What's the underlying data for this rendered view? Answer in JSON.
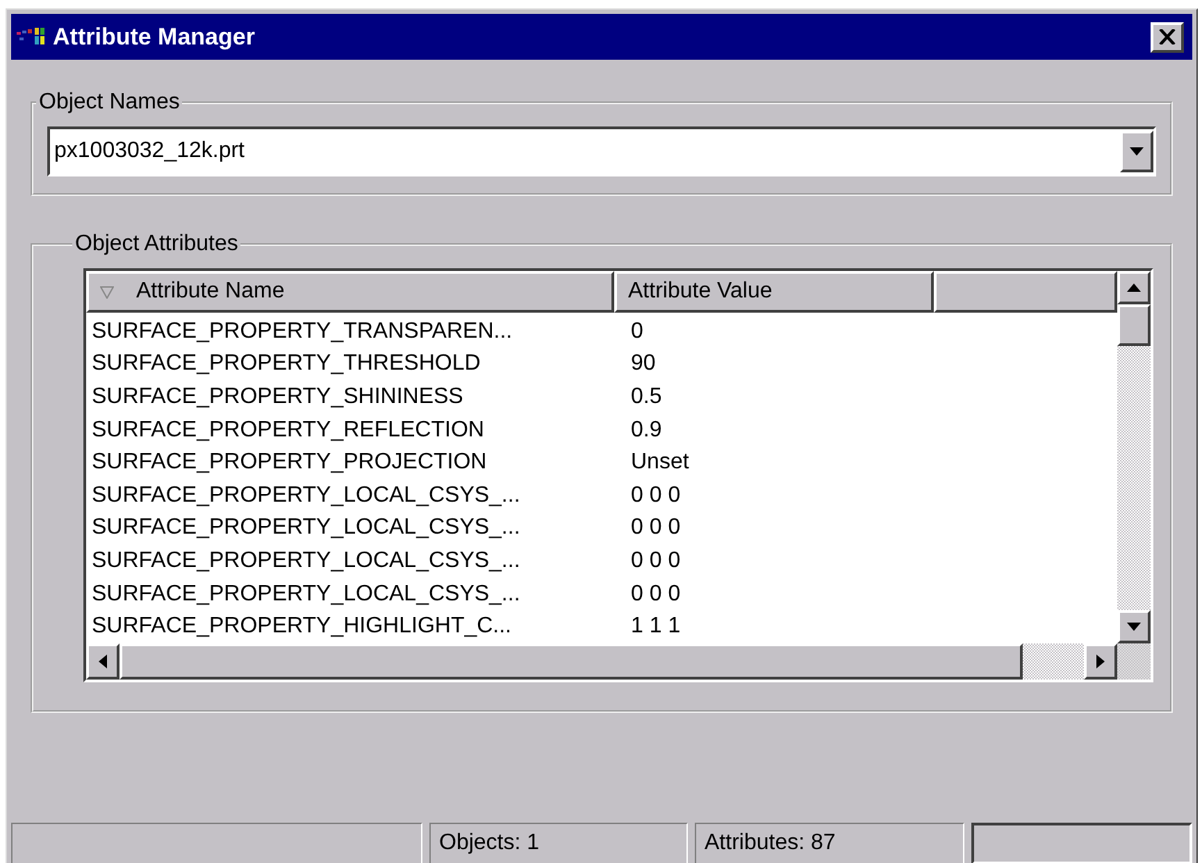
{
  "window": {
    "title": "Attribute Manager"
  },
  "object_names": {
    "label": "Object Names",
    "value": "px1003032_12k.prt"
  },
  "object_attributes": {
    "label": "Object Attributes",
    "columns": [
      {
        "label": "Attribute Name",
        "sorted": true
      },
      {
        "label": "Attribute Value",
        "sorted": false
      }
    ],
    "rows": [
      {
        "name": "SURFACE_PROPERTY_TRANSPAREN...",
        "value": "0"
      },
      {
        "name": "SURFACE_PROPERTY_THRESHOLD",
        "value": "90"
      },
      {
        "name": "SURFACE_PROPERTY_SHININESS",
        "value": "0.5"
      },
      {
        "name": "SURFACE_PROPERTY_REFLECTION",
        "value": "0.9"
      },
      {
        "name": "SURFACE_PROPERTY_PROJECTION",
        "value": "Unset"
      },
      {
        "name": "SURFACE_PROPERTY_LOCAL_CSYS_...",
        "value": "0 0 0"
      },
      {
        "name": "SURFACE_PROPERTY_LOCAL_CSYS_...",
        "value": "0 0 0"
      },
      {
        "name": "SURFACE_PROPERTY_LOCAL_CSYS_...",
        "value": "0 0 0"
      },
      {
        "name": "SURFACE_PROPERTY_LOCAL_CSYS_...",
        "value": "0 0 0"
      },
      {
        "name": "SURFACE_PROPERTY_HIGHLIGHT_C...",
        "value": "1 1 1"
      }
    ]
  },
  "status_bar": {
    "objects": "Objects: 1",
    "attributes": "Attributes: 87"
  }
}
